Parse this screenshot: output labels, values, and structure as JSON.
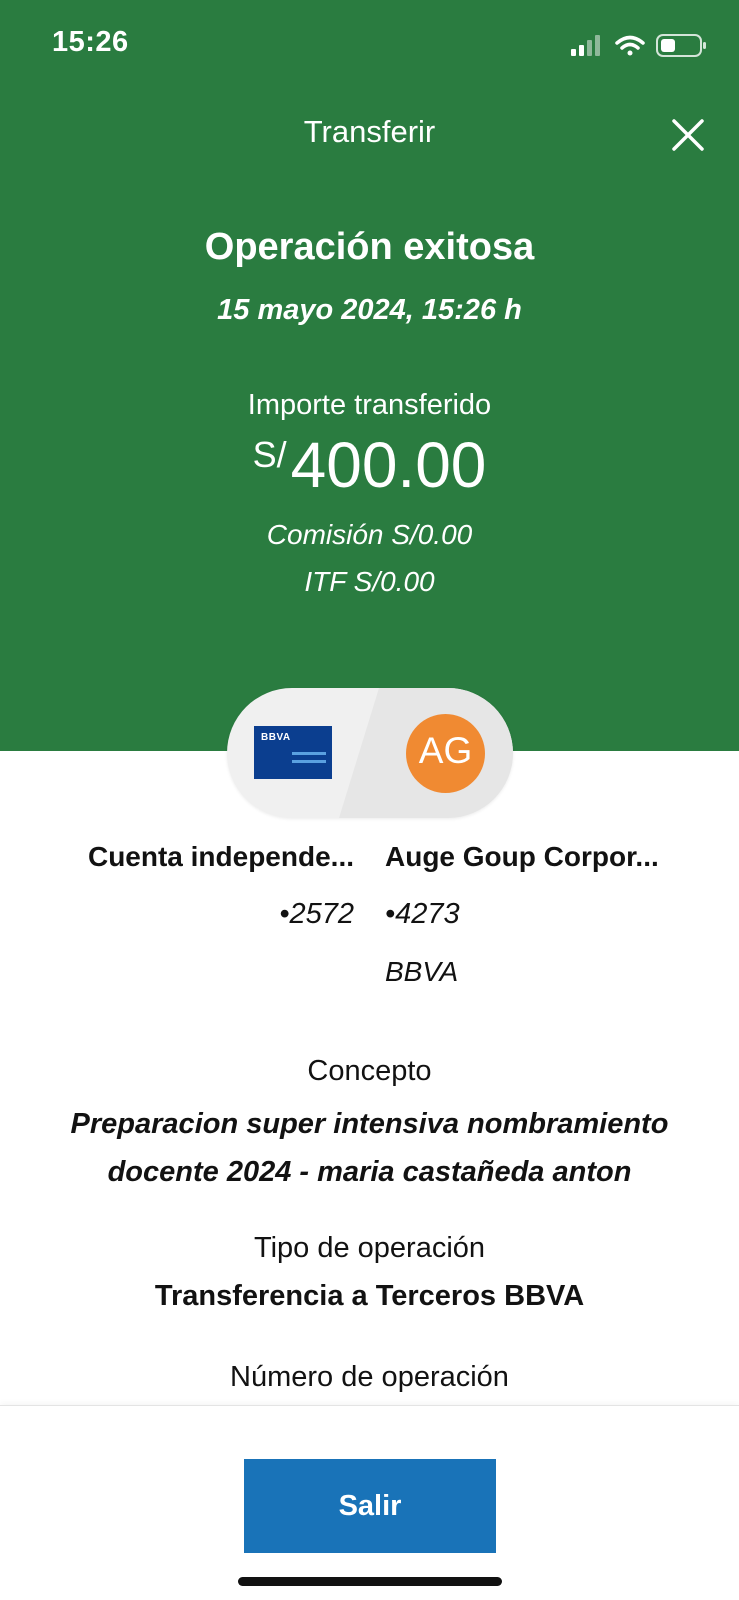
{
  "status_bar": {
    "time": "15:26"
  },
  "header": {
    "title": "Transferir"
  },
  "operation": {
    "title": "Operación exitosa",
    "date": "15 mayo 2024, 15:26 h",
    "amount_label": "Importe transferido",
    "currency": "S/",
    "amount": "400.00",
    "commission": "Comisión  S/0.00",
    "itf": "ITF  S/0.00"
  },
  "from_account": {
    "logo": "BBVA",
    "name": "Cuenta independe...",
    "number": "•2572"
  },
  "to_account": {
    "initials": "AG",
    "name": "Auge Goup Corpor...",
    "number": "•4273",
    "bank": "BBVA"
  },
  "details": {
    "concept_label": "Concepto",
    "concept_value": "Preparacion super intensiva nombramiento docente 2024 - maria castañeda anton",
    "type_label": "Tipo de operación",
    "type_value": "Transferencia a Terceros BBVA",
    "number_label": "Número de operación"
  },
  "footer": {
    "exit_label": "Salir"
  },
  "colors": {
    "header_green": "#2a7c40",
    "button_blue": "#1973b8",
    "avatar_orange": "#f08a32",
    "card_blue": "#0b3e8f"
  },
  "icons": [
    "signal-icon",
    "wifi-icon",
    "battery-icon",
    "close-icon",
    "bbva-card-icon"
  ]
}
